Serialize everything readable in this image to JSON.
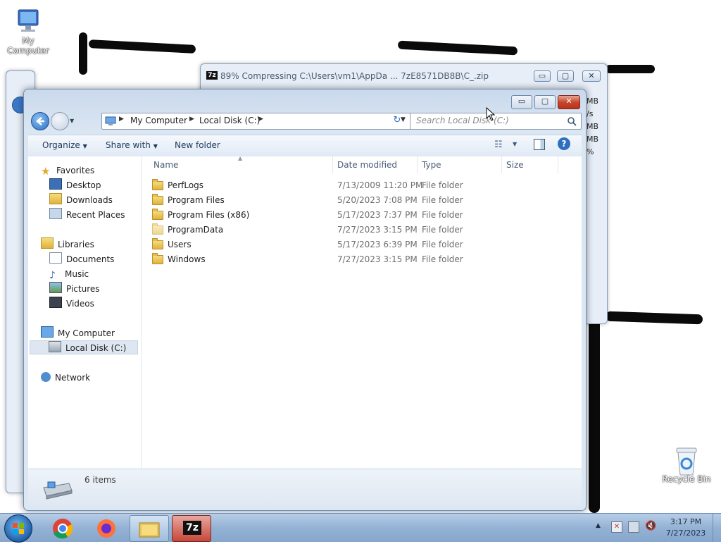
{
  "desktop": {
    "my_computer": "My Computer",
    "recycle_bin": "Recycle Bin"
  },
  "bg_window": {
    "icon": "7z",
    "title": "89% Compressing C:\\Users\\vm1\\AppDa ... 7zE8571DB8B\\C_.zip",
    "side_text": [
      "MB",
      "/s",
      "MB",
      "MB",
      "%"
    ]
  },
  "explorer": {
    "caption_buttons": {
      "minimize": "▭",
      "maximize": "▢",
      "close": "✕"
    },
    "address": {
      "root": "My Computer",
      "current": "Local Disk (C:)"
    },
    "search_placeholder": "Search Local Disk (C:)",
    "toolbar": {
      "organize": "Organize",
      "share_with": "Share with",
      "new_folder": "New folder"
    },
    "nav": {
      "favorites": "Favorites",
      "desktop": "Desktop",
      "downloads": "Downloads",
      "recent_places": "Recent Places",
      "libraries": "Libraries",
      "documents": "Documents",
      "music": "Music",
      "pictures": "Pictures",
      "videos": "Videos",
      "my_computer": "My Computer",
      "local_disk": "Local Disk (C:)",
      "network": "Network"
    },
    "columns": {
      "name": "Name",
      "date": "Date modified",
      "type": "Type",
      "size": "Size"
    },
    "files": [
      {
        "name": "PerfLogs",
        "date": "7/13/2009 11:20 PM",
        "type": "File folder"
      },
      {
        "name": "Program Files",
        "date": "5/20/2023 7:08 PM",
        "type": "File folder"
      },
      {
        "name": "Program Files (x86)",
        "date": "5/17/2023 7:37 PM",
        "type": "File folder"
      },
      {
        "name": "ProgramData",
        "date": "7/27/2023 3:15 PM",
        "type": "File folder"
      },
      {
        "name": "Users",
        "date": "5/17/2023 6:39 PM",
        "type": "File folder"
      },
      {
        "name": "Windows",
        "date": "7/27/2023 3:15 PM",
        "type": "File folder"
      }
    ],
    "status": "6 items"
  },
  "taskbar": {
    "app_7z": "7z",
    "time": "3:17 PM",
    "date": "7/27/2023"
  }
}
